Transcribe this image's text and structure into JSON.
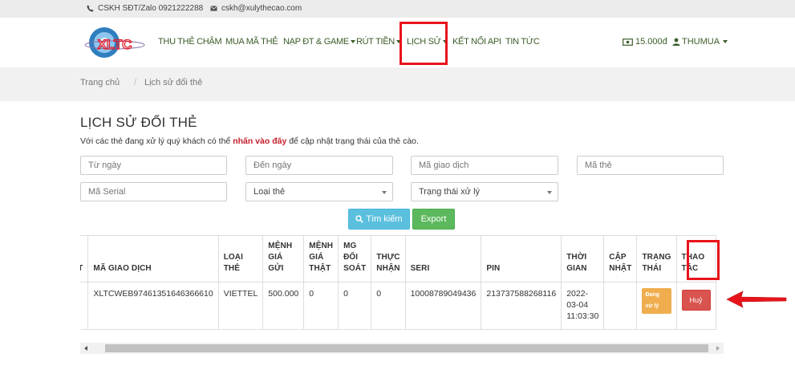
{
  "topbar": {
    "phone": "CSKH SĐT/Zalo 0921222288",
    "email": "cskh@xulythecao.com",
    "phone_icon": "phone-icon",
    "email_icon": "envelope-icon"
  },
  "brand": {
    "logo_text": "XLTC"
  },
  "nav": {
    "items": [
      {
        "label": "THU THẺ CHẬM",
        "has_dropdown": false
      },
      {
        "label": "MUA MÃ THẺ",
        "has_dropdown": false
      },
      {
        "label": "NẠP ĐT & GAME",
        "has_dropdown": true
      },
      {
        "label": "RÚT TIỀN",
        "has_dropdown": true
      },
      {
        "label": "LỊCH SỬ",
        "has_dropdown": true,
        "highlighted": true
      },
      {
        "label": "KẾT NỐI API",
        "has_dropdown": false
      },
      {
        "label": "TIN TỨC",
        "has_dropdown": false
      }
    ],
    "balance": "15.000đ",
    "user": "THUMUA"
  },
  "breadcrumb": {
    "home": "Trang chủ",
    "separator": "/",
    "current": "Lịch sử đổi thẻ"
  },
  "page": {
    "title": "LỊCH SỬ ĐỔI THẺ",
    "intro_before": "Với các thẻ đang xử lý quý khách có thể ",
    "intro_link": "nhấn vào đây",
    "intro_after": " để cập nhật trạng thái của thẻ cào."
  },
  "filters": {
    "from_date": "Từ ngày",
    "to_date": "Đến ngày",
    "transaction_code": "Mã giao dịch",
    "card_code": "Mã thẻ",
    "serial": "Mã Serial",
    "card_type": "Loại thẻ",
    "status": "Trạng thái xử lý"
  },
  "buttons": {
    "search": "Tìm kiếm",
    "export": "Export"
  },
  "table": {
    "headers": {
      "tt": "TT",
      "code": "MÃ GIAO DỊCH",
      "type": [
        "LOẠI",
        "THẺ"
      ],
      "sent": [
        "MỆNH",
        "GIÁ GỬI"
      ],
      "real": [
        "MỆNH",
        "GIÁ",
        "THẬT"
      ],
      "rate": [
        "MG",
        "ĐỐI",
        "SOÁT"
      ],
      "received": [
        "THỰC",
        "NHẬN"
      ],
      "serial": "SERI",
      "pin": "PIN",
      "time": [
        "THỜI",
        "GIAN"
      ],
      "updated": [
        "CẬP",
        "NHẬT"
      ],
      "status": [
        "TRẠNG",
        "THÁI"
      ],
      "action": [
        "THAO",
        "TÁC"
      ]
    },
    "rows": [
      {
        "tt": "",
        "code": "XLTCWEB97461351646366610",
        "type": "VIETTEL",
        "sent": "500.000",
        "real": "0",
        "rate": "0",
        "received": "0",
        "serial": "10008789049436",
        "pin": "213737588268116",
        "time": [
          "2022-",
          "03-04",
          "11:03:30"
        ],
        "updated": "",
        "status": "Đang xử lý",
        "action": "Huỷ"
      }
    ]
  },
  "colors": {
    "nav_text": "#3b5c28",
    "highlight": "#e8141b",
    "search_button": "#5bc0de",
    "export_button": "#5cb85c",
    "status_badge": "#f0ad4e",
    "cancel_button": "#d9534f",
    "intro_link": "#c41e2c"
  }
}
